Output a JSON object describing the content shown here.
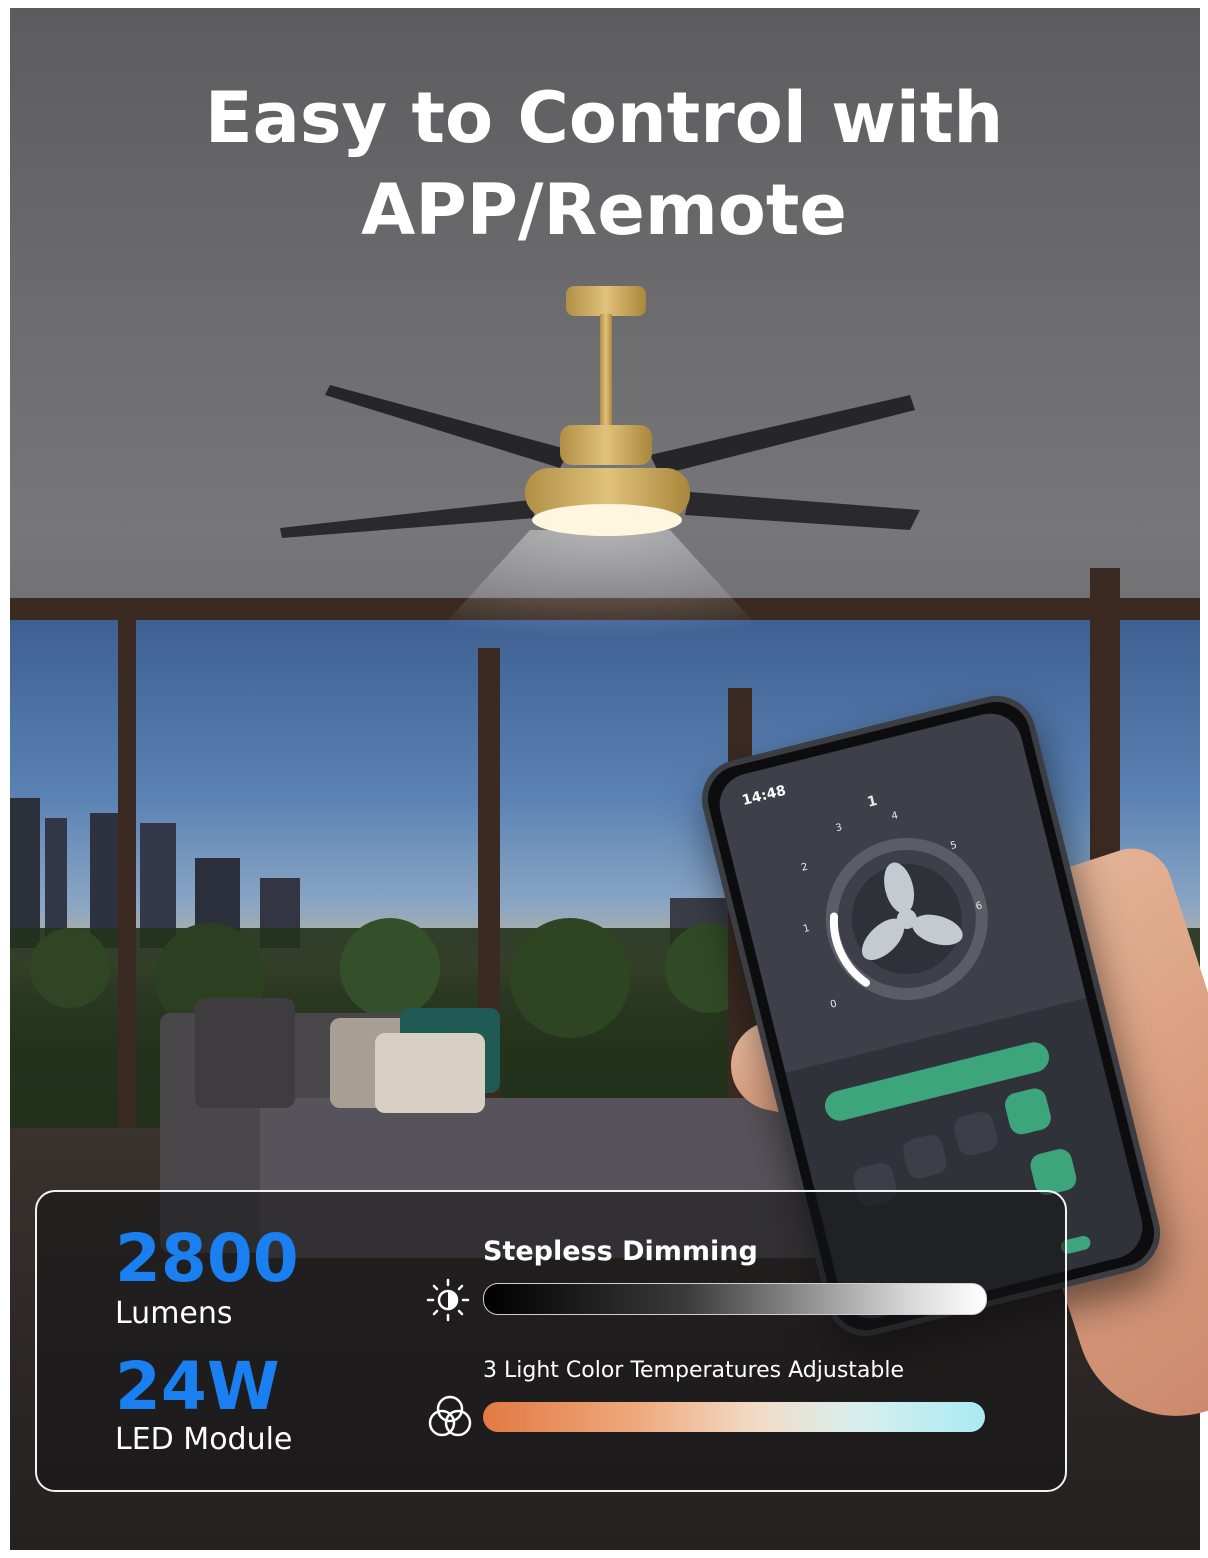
{
  "headline": {
    "line1": "Easy to Control with",
    "line2": "APP/Remote"
  },
  "phone": {
    "status_time": "14:48",
    "speed_levels": [
      "0",
      "1",
      "2",
      "3",
      "4",
      "5",
      "6"
    ],
    "current_speed": "1"
  },
  "specs": {
    "lumens_value": "2800",
    "lumens_label": "Lumens",
    "power_value": "24W",
    "power_label": "LED Module"
  },
  "features": {
    "dimming_title": "Stepless Dimming",
    "dimming_icon": "brightness-icon",
    "color_title": "3 Light Color Temperatures Adjustable",
    "color_icon": "color-circles-icon"
  },
  "colors": {
    "accent_blue": "#1a7ff0",
    "app_green": "#3da57c",
    "warm_orange": "#e27a43",
    "cool_cyan": "#a9eaf3"
  }
}
